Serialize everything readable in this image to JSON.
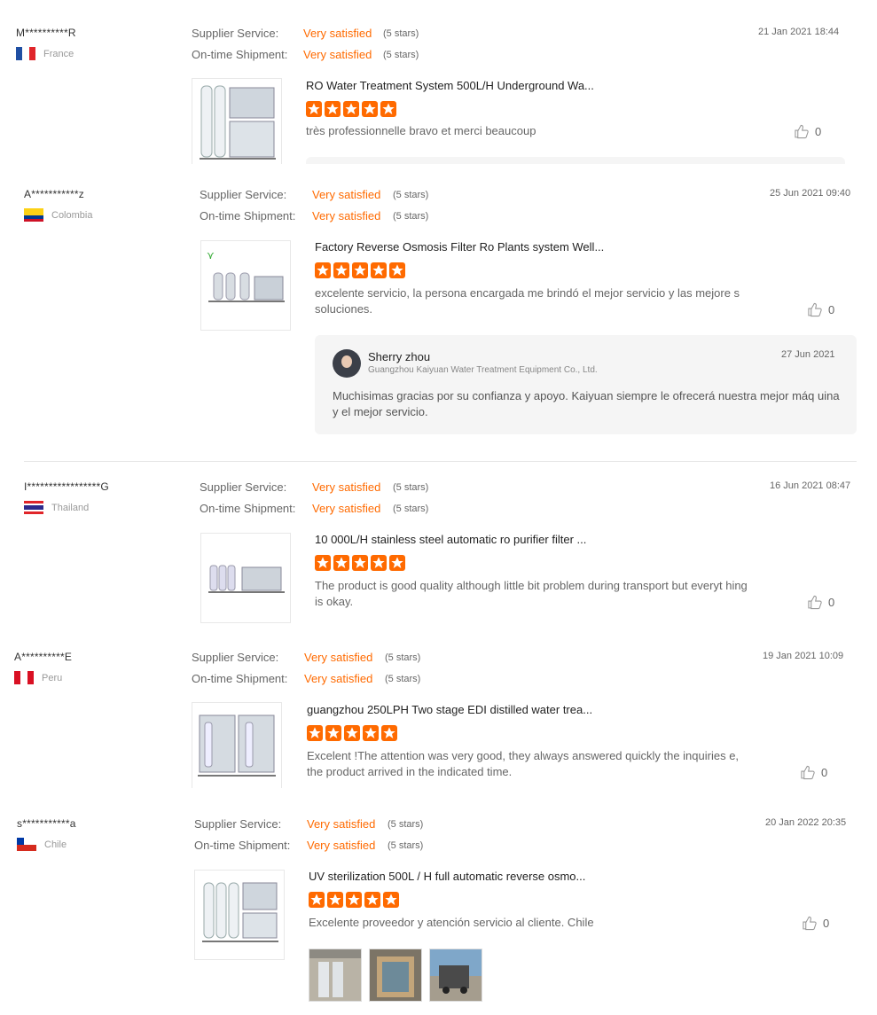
{
  "labels": {
    "supplier_service": "Supplier Service:",
    "shipment": "On-time Shipment:"
  },
  "reviews": [
    {
      "buyer": "M**********R",
      "country": "France",
      "rating_service": "Very satisfied",
      "stars_service": "(5 stars)",
      "rating_shipment": "Very satisfied",
      "stars_shipment": "(5 stars)",
      "date": "21 Jan 2021 18:44",
      "product": "RO Water Treatment System 500L/H Underground Wa...",
      "stars": 5,
      "comment": "très professionnelle bravo et merci beaucoup",
      "likes": "0"
    },
    {
      "buyer": "A***********z",
      "country": "Colombia",
      "rating_service": "Very satisfied",
      "stars_service": "(5 stars)",
      "rating_shipment": "Very satisfied",
      "stars_shipment": "(5 stars)",
      "date": "25 Jun 2021 09:40",
      "product": "Factory Reverse Osmosis Filter Ro Plants system Well...",
      "stars": 5,
      "comment": "excelente servicio, la persona encargada me brindó el mejor servicio y las mejore s soluciones.",
      "likes": "0",
      "reply": {
        "name": "Sherry zhou",
        "company": "Guangzhou Kaiyuan Water Treatment Equipment Co., Ltd.",
        "date": "27 Jun 2021",
        "text": "Muchisimas gracias por su confianza y apoyo. Kaiyuan siempre le ofrecerá nuestra mejor máq uina y el mejor servicio."
      }
    },
    {
      "buyer": "I*****************G",
      "country": "Thailand",
      "rating_service": "Very satisfied",
      "stars_service": "(5 stars)",
      "rating_shipment": "Very satisfied",
      "stars_shipment": "(5 stars)",
      "date": "16 Jun 2021 08:47",
      "product": "10 000L/H stainless steel automatic ro purifier filter ...",
      "stars": 5,
      "comment": "The product is good quality although little bit problem during transport but everyt hing is okay.",
      "likes": "0"
    },
    {
      "buyer": "A**********E",
      "country": "Peru",
      "rating_service": "Very satisfied",
      "stars_service": "(5 stars)",
      "rating_shipment": "Very satisfied",
      "stars_shipment": "(5 stars)",
      "date": "19 Jan 2021 10:09",
      "product": "guangzhou 250LPH Two stage EDI distilled water trea...",
      "stars": 5,
      "comment": "Excelent !The attention was very good, they always answered quickly the inquiries e, the product arrived in the indicated time.",
      "likes": "0"
    },
    {
      "buyer": "s***********a",
      "country": "Chile",
      "rating_service": "Very satisfied",
      "stars_service": "(5 stars)",
      "rating_shipment": "Very satisfied",
      "stars_shipment": "(5 stars)",
      "date": "20 Jan 2022 20:35",
      "product": "UV sterilization 500L / H full automatic reverse osmo...",
      "stars": 5,
      "comment": "Excelente proveedor y atención servicio al cliente. Chile",
      "likes": "0"
    }
  ],
  "colors": {
    "accent": "#ff6a00"
  }
}
